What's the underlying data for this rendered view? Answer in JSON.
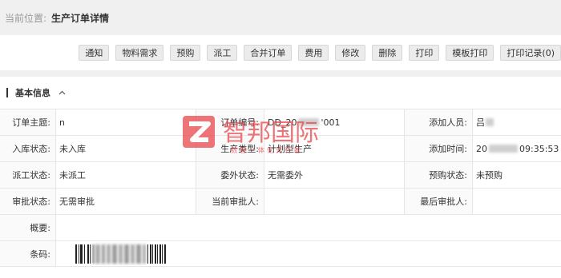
{
  "breadcrumb": {
    "label": "当前位置:",
    "current": "生产订单详情"
  },
  "toolbar": {
    "buttons": [
      "通知",
      "物料需求",
      "预购",
      "派工",
      "合并订单",
      "费用",
      "修改",
      "删除",
      "打印",
      "模板打印",
      "打印记录(0)"
    ]
  },
  "section": {
    "title": "基本信息",
    "toggle_icon": "chevron-up-icon"
  },
  "fields": {
    "subject_label": "订单主题:",
    "subject_value": "n",
    "order_no_label": "订单编号:",
    "order_no_value_a": "DD_20",
    "order_no_value_b": "'001",
    "added_by_label": "添加人员:",
    "added_by_value": "吕",
    "stock_status_label": "入库状态:",
    "stock_status_value": "未入库",
    "prod_type_label": "生产类型:",
    "prod_type_value": "计划型生产",
    "added_time_label": "添加时间:",
    "added_time_value_a": "20",
    "added_time_value_b": "09:35:53",
    "dispatch_label": "派工状态:",
    "dispatch_value": "未派工",
    "outsource_label": "委外状态:",
    "outsource_value": "无需委外",
    "prepurchase_label": "预购状态:",
    "prepurchase_value": "未预购",
    "approval_label": "审批状态:",
    "approval_value": "无需审批",
    "current_approver_label": "当前审批人:",
    "current_approver_value": "",
    "last_approver_label": "最后审批人:",
    "last_approver_value": "",
    "summary_label": "概要:",
    "summary_value": "",
    "barcode_label": "条码:"
  },
  "watermark": {
    "text": "智邦国际",
    "subtext": "数 智 一 体 化 先 行 者",
    "color": "#e8474c"
  }
}
